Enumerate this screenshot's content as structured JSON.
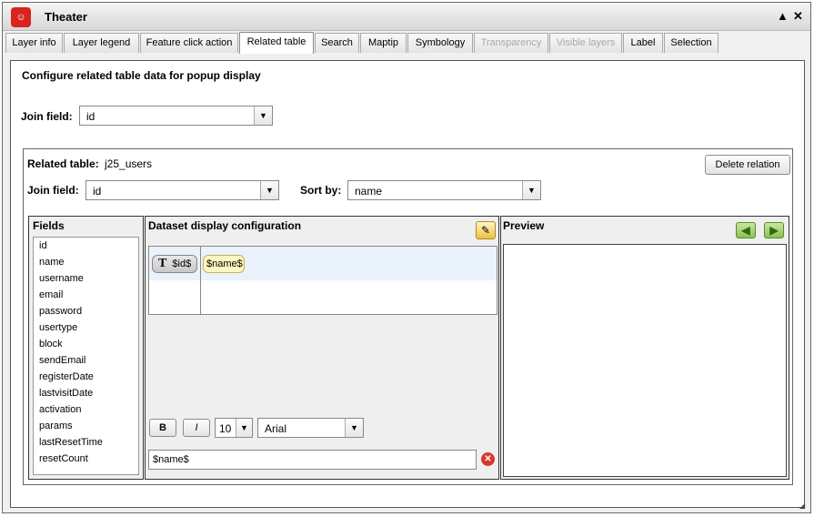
{
  "window": {
    "title": "Theater",
    "app_icon": "theater-masks-icon",
    "brand_color": "#d8231f"
  },
  "tabs": [
    {
      "label": "Layer info"
    },
    {
      "label": "Layer legend"
    },
    {
      "label": "Feature click action"
    },
    {
      "label": "Related table"
    },
    {
      "label": "Search"
    },
    {
      "label": "Maptip"
    },
    {
      "label": "Symbology"
    },
    {
      "label": "Transparency"
    },
    {
      "label": "Visible layers"
    },
    {
      "label": "Label"
    },
    {
      "label": "Selection"
    }
  ],
  "main": {
    "heading": "Configure related table data for popup display",
    "join_field_label": "Join field:",
    "join_field_value": "id"
  },
  "relation": {
    "related_table_label": "Related table:",
    "related_table_value": "j25_users",
    "delete_button": "Delete relation",
    "join_field_label": "Join field:",
    "join_field_value": "id",
    "sort_by_label": "Sort by:",
    "sort_by_value": "name"
  },
  "fields_panel": {
    "title": "Fields",
    "items": [
      "id",
      "name",
      "username",
      "email",
      "password",
      "usertype",
      "block",
      "sendEmail",
      "registerDate",
      "lastvisitDate",
      "activation",
      "params",
      "lastResetTime",
      "resetCount"
    ]
  },
  "dataset_panel": {
    "title": "Dataset display configuration",
    "tokens": [
      "$id$",
      "$name$"
    ],
    "bold_label": "B",
    "italic_label": "I",
    "font_size": "10",
    "font_family": "Arial",
    "expression": "$name$"
  },
  "preview_panel": {
    "title": "Preview"
  }
}
